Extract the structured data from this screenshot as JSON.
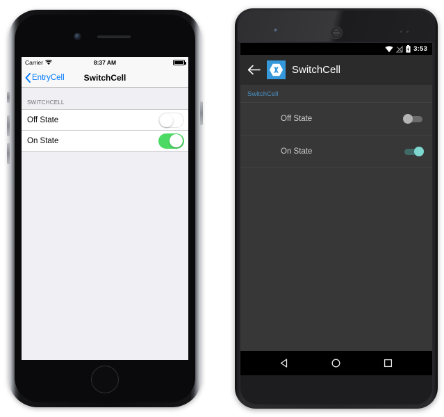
{
  "ios": {
    "device_name": "iphone-device",
    "status_bar": {
      "carrier": "Carrier",
      "wifi_icon": "wifi-icon",
      "time": "8:37 AM",
      "battery_icon": "battery-full-icon"
    },
    "nav_bar": {
      "back_chevron_icon": "chevron-left-icon",
      "back_label": "EntryCell",
      "title": "SwitchCell"
    },
    "table": {
      "section_header": "SWITCHCELL",
      "rows": [
        {
          "label": "Off State",
          "state": "off",
          "switch_icon": "toggle-switch-off-icon"
        },
        {
          "label": "On State",
          "state": "on",
          "switch_icon": "toggle-switch-on-icon"
        }
      ]
    },
    "hardware": {
      "camera": "front-camera",
      "speaker": "earpiece-speaker",
      "home_button": "home-button",
      "silent_switch": "silent-switch",
      "volume_up": "volume-up-button",
      "volume_down": "volume-down-button",
      "power": "power-button"
    },
    "colors": {
      "accent": "#007aff",
      "switch_on": "#4cd964",
      "table_bg": "#efeff4",
      "nav_bg": "#f8f8f8"
    }
  },
  "android": {
    "device_name": "android-device",
    "status_bar": {
      "wifi_icon": "wifi-icon",
      "signal_icon": "no-signal-icon",
      "battery_icon": "battery-charging-icon",
      "time": "3:53"
    },
    "toolbar": {
      "back_arrow_icon": "arrow-left-icon",
      "app_logo_icon": "xamarin-logo-icon",
      "title": "SwitchCell"
    },
    "content": {
      "section_header": "SwitchCell",
      "rows": [
        {
          "label": "Off State",
          "state": "off",
          "switch_icon": "toggle-switch-off-icon"
        },
        {
          "label": "On State",
          "state": "on",
          "switch_icon": "toggle-switch-on-icon"
        }
      ]
    },
    "nav_bar": {
      "back_icon": "nav-back-triangle-icon",
      "home_icon": "nav-home-circle-icon",
      "recents_icon": "nav-recents-square-icon"
    },
    "hardware": {
      "camera": "front-camera",
      "speaker": "earpiece-speaker",
      "sensors": "proximity-sensors"
    },
    "colors": {
      "accent": "#4a90c4",
      "logo_bg": "#3498db",
      "switch_on_thumb": "#7fd8d0",
      "screen_bg": "#373737",
      "toolbar_bg": "#2b2b2b"
    }
  }
}
